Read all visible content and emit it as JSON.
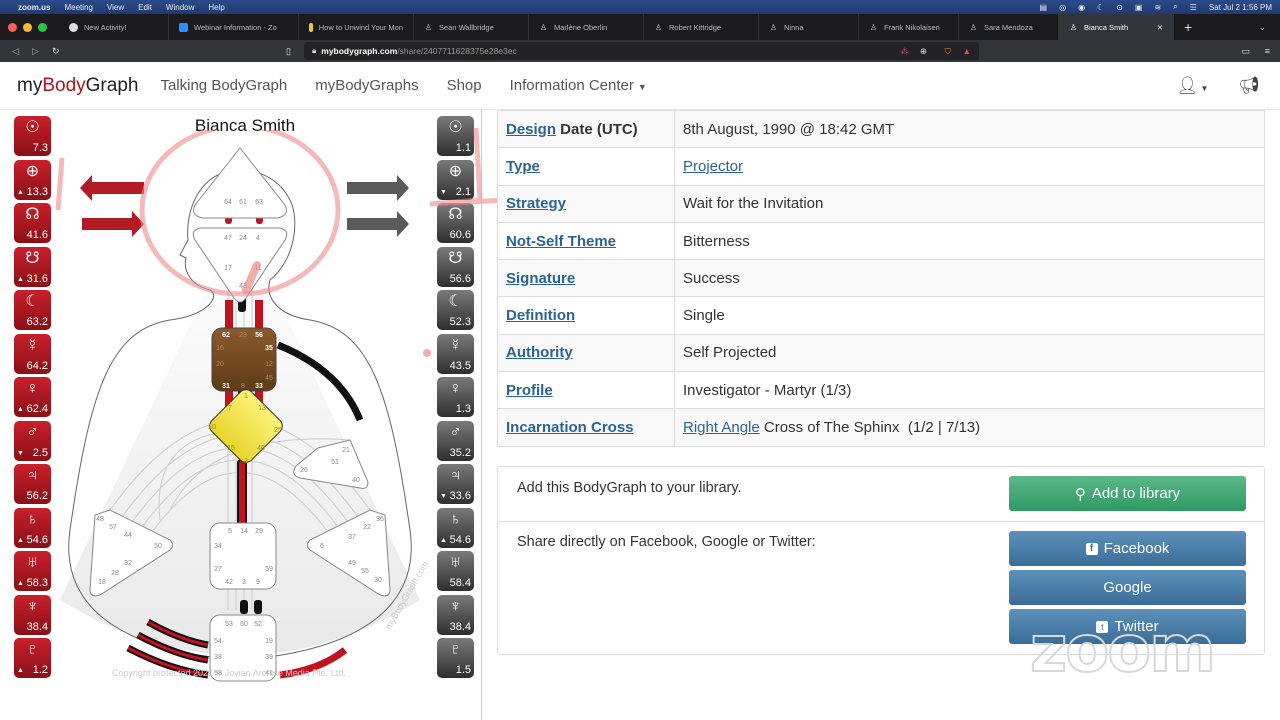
{
  "mac_menubar": {
    "app": "zoom.us",
    "menus": [
      "Meeting",
      "View",
      "Edit",
      "Window",
      "Help"
    ],
    "clock": "Sat Jul 2  1:56 PM"
  },
  "browser": {
    "tabs": [
      {
        "label": "New Activity!",
        "icon": "activity-icon"
      },
      {
        "label": "Webinar Information - Zo",
        "icon": "zoom-icon"
      },
      {
        "label": "How to Unwind Your Mon",
        "icon": "doc-icon"
      },
      {
        "label": "Sean Wallbridge",
        "icon": "bodygraph-icon"
      },
      {
        "label": "Marlène Oberlin",
        "icon": "bodygraph-icon"
      },
      {
        "label": "Robert Kittridge",
        "icon": "bodygraph-icon"
      },
      {
        "label": "Ninna",
        "icon": "bodygraph-icon"
      },
      {
        "label": "Frank Nikolaisen",
        "icon": "bodygraph-icon"
      },
      {
        "label": "Sara Mendoza",
        "icon": "bodygraph-icon"
      },
      {
        "label": "Bianca Smith",
        "icon": "bodygraph-icon",
        "active": true
      }
    ],
    "url_host": "mybodygraph.com",
    "url_path": "/share/2407711628375e28e3ec"
  },
  "navbar": {
    "brand_pre": "my",
    "brand_mid": "Body",
    "brand_post": "Graph",
    "links": [
      "Talking BodyGraph",
      "myBodyGraphs",
      "Shop",
      "Information Center"
    ],
    "accent": "#b5121b"
  },
  "chart": {
    "name": "Bianca Smith",
    "design_planets": [
      {
        "planet": "Sun",
        "symbol": "☉",
        "value": "7.3",
        "arrow": ""
      },
      {
        "planet": "Earth",
        "symbol": "⊕",
        "value": "13.3",
        "arrow": "▲"
      },
      {
        "planet": "North Node",
        "symbol": "☊",
        "value": "41.6",
        "arrow": ""
      },
      {
        "planet": "South Node",
        "symbol": "☋",
        "value": "31.6",
        "arrow": "▲"
      },
      {
        "planet": "Moon",
        "symbol": "☾",
        "value": "63.2",
        "arrow": ""
      },
      {
        "planet": "Mercury",
        "symbol": "☿",
        "value": "64.2",
        "arrow": ""
      },
      {
        "planet": "Venus",
        "symbol": "♀",
        "value": "62.4",
        "arrow": "▲"
      },
      {
        "planet": "Mars",
        "symbol": "♂",
        "value": "2.5",
        "arrow": "▼"
      },
      {
        "planet": "Jupiter",
        "symbol": "♃",
        "value": "56.2",
        "arrow": ""
      },
      {
        "planet": "Saturn",
        "symbol": "♄",
        "value": "54.6",
        "arrow": "▲"
      },
      {
        "planet": "Uranus",
        "symbol": "♅",
        "value": "58.3",
        "arrow": "▲"
      },
      {
        "planet": "Neptune",
        "symbol": "♆",
        "value": "38.4",
        "arrow": ""
      },
      {
        "planet": "Pluto",
        "symbol": "♇",
        "value": "1.2",
        "arrow": "▲"
      }
    ],
    "personality_planets": [
      {
        "planet": "Sun",
        "symbol": "☉",
        "value": "1.1",
        "arrow": ""
      },
      {
        "planet": "Earth",
        "symbol": "⊕",
        "value": "2.1",
        "arrow": "▼"
      },
      {
        "planet": "North Node",
        "symbol": "☊",
        "value": "60.6",
        "arrow": ""
      },
      {
        "planet": "South Node",
        "symbol": "☋",
        "value": "56.6",
        "arrow": ""
      },
      {
        "planet": "Moon",
        "symbol": "☾",
        "value": "52.3",
        "arrow": ""
      },
      {
        "planet": "Mercury",
        "symbol": "☿",
        "value": "43.5",
        "arrow": ""
      },
      {
        "planet": "Venus",
        "symbol": "♀",
        "value": "1.3",
        "arrow": ""
      },
      {
        "planet": "Mars",
        "symbol": "♂",
        "value": "35.2",
        "arrow": ""
      },
      {
        "planet": "Jupiter",
        "symbol": "♃",
        "value": "33.6",
        "arrow": "▼"
      },
      {
        "planet": "Saturn",
        "symbol": "♄",
        "value": "54.6",
        "arrow": "▲"
      },
      {
        "planet": "Uranus",
        "symbol": "♅",
        "value": "58.4",
        "arrow": ""
      },
      {
        "planet": "Neptune",
        "symbol": "♆",
        "value": "38.4",
        "arrow": ""
      },
      {
        "planet": "Pluto",
        "symbol": "♇",
        "value": "1.5",
        "arrow": ""
      }
    ],
    "centers": {
      "head": {
        "gates": [
          "64",
          "61",
          "63"
        ],
        "defined": false
      },
      "ajna": {
        "gates": [
          "47",
          "24",
          "4",
          "17",
          "11",
          "43"
        ],
        "defined": false
      },
      "throat": {
        "gates": [
          "62",
          "23",
          "56",
          "16",
          "35",
          "20",
          "12",
          "45",
          "31",
          "8",
          "33"
        ],
        "defined": true,
        "color": "#7a4a22"
      },
      "g": {
        "gates": [
          "1",
          "7",
          "13",
          "10",
          "25",
          "15",
          "46",
          "2"
        ],
        "defined": true,
        "color": "#f2e24a"
      },
      "heart": {
        "gates": [
          "21",
          "51",
          "26",
          "40"
        ],
        "defined": false
      },
      "spleen": {
        "gates": [
          "48",
          "57",
          "44",
          "50",
          "32",
          "28",
          "18"
        ],
        "defined": false
      },
      "solar_plexus": {
        "gates": [
          "36",
          "22",
          "37",
          "6",
          "49",
          "55",
          "30"
        ],
        "defined": false
      },
      "sacral": {
        "gates": [
          "5",
          "14",
          "29",
          "34",
          "27",
          "59",
          "42",
          "3",
          "9"
        ],
        "defined": false
      },
      "root": {
        "gates": [
          "53",
          "60",
          "52",
          "54",
          "38",
          "58",
          "19",
          "39",
          "41"
        ],
        "defined": false
      }
    },
    "watermark": "myBodyGraph.com",
    "copyright": "Copyright protected 2022 © Jovian Archive Media Pte. Ltd."
  },
  "properties": [
    {
      "key_link": "Design",
      "key_rest": " Date (UTC)",
      "value": "8th August, 1990 @ 18:42 GMT"
    },
    {
      "key_link": "Type",
      "key_rest": "",
      "value_link": "Projector",
      "value": ""
    },
    {
      "key_link": "Strategy",
      "key_rest": "",
      "value": "Wait for the Invitation"
    },
    {
      "key_link": "Not-Self Theme",
      "key_rest": "",
      "value": "Bitterness"
    },
    {
      "key_link": "Signature",
      "key_rest": "",
      "value": "Success"
    },
    {
      "key_link": "Definition",
      "key_rest": "",
      "value": "Single"
    },
    {
      "key_link": "Authority",
      "key_rest": "",
      "value": "Self Projected"
    },
    {
      "key_link": "Profile",
      "key_rest": "",
      "value": "Investigator - Martyr (1/3)"
    },
    {
      "key_link": "Incarnation Cross",
      "key_rest": "",
      "value_link": "Right Angle",
      "value": " Cross of The Sphinx  (1/2 | 7/13)"
    }
  ],
  "library": {
    "text": "Add this BodyGraph to your library.",
    "button": "Add to library"
  },
  "share": {
    "text": "Share directly on Facebook, Google or Twitter:",
    "facebook": "Facebook",
    "google": "Google",
    "twitter": "Twitter"
  },
  "overlay": {
    "zoom_watermark": "zoom"
  }
}
